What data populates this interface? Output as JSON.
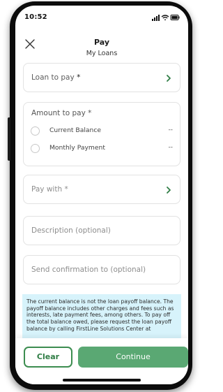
{
  "status_bar": {
    "time": "10:52",
    "icons": [
      "signal-icon",
      "wifi-icon",
      "battery-icon"
    ]
  },
  "header": {
    "title": "Pay",
    "subtitle": "My Loans",
    "close_icon": "close-icon"
  },
  "loan_to_pay": {
    "label": "Loan to pay",
    "required_mark": "*"
  },
  "amount_to_pay": {
    "label": "Amount to pay",
    "required_mark": "*",
    "options": [
      {
        "label": "Current Balance",
        "value": "--"
      },
      {
        "label": "Monthly Payment",
        "value": "--"
      }
    ]
  },
  "pay_with": {
    "label": "Pay with",
    "required_mark": "*"
  },
  "description": {
    "placeholder": "Description (optional)"
  },
  "confirmation": {
    "placeholder": "Send confirmation to (optional)"
  },
  "info_text": "The current balance is not the loan payoff balance. The payoff balance includes other charges and fees such as interests, late payment fees, among others. To pay off the total balance owed, please request the loan payoff balance by calling FirstLine Solutions Center at",
  "buttons": {
    "clear": "Clear",
    "continue": "Continue"
  },
  "colors": {
    "primary_green": "#5aa873",
    "outline_green": "#3c8d50",
    "chevron_green": "#2f7d45",
    "info_background": "#d7f3fb"
  }
}
